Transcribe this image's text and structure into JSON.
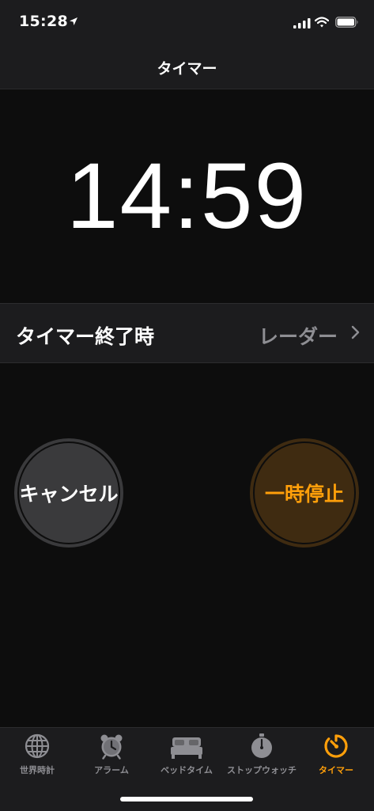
{
  "status_bar": {
    "time": "15:28",
    "icons": [
      "location-arrow-icon",
      "cellular-signal-icon",
      "wifi-icon",
      "battery-icon"
    ]
  },
  "nav": {
    "title": "タイマー"
  },
  "timer": {
    "remaining": "14:59"
  },
  "timer_end_row": {
    "label": "タイマー終了時",
    "value": "レーダー",
    "icon": "chevron-right-icon"
  },
  "buttons": {
    "cancel": "キャンセル",
    "pause": "一時停止"
  },
  "tabs": [
    {
      "label": "世界時計",
      "icon": "globe-icon",
      "active": false
    },
    {
      "label": "アラーム",
      "icon": "alarm-clock-icon",
      "active": false
    },
    {
      "label": "ベッドタイム",
      "icon": "bed-icon",
      "active": false
    },
    {
      "label": "ストップウォッチ",
      "icon": "stopwatch-icon",
      "active": false
    },
    {
      "label": "タイマー",
      "icon": "timer-icon",
      "active": true
    }
  ],
  "colors": {
    "accent": "#ff9f0a",
    "background": "#0d0d0d",
    "bar": "#1c1c1e",
    "secondary_text": "#8e8e93",
    "cancel_button": "#3a3a3c",
    "pause_button": "#3f2b11"
  }
}
